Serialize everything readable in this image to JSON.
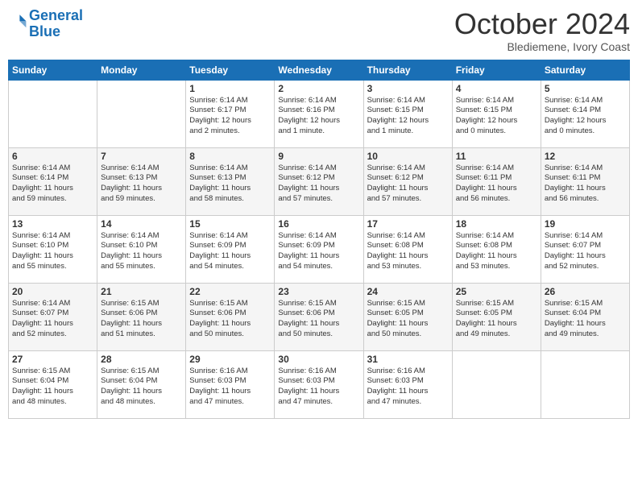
{
  "logo": {
    "line1": "General",
    "line2": "Blue"
  },
  "title": "October 2024",
  "location": "Blediemene, Ivory Coast",
  "days_header": [
    "Sunday",
    "Monday",
    "Tuesday",
    "Wednesday",
    "Thursday",
    "Friday",
    "Saturday"
  ],
  "weeks": [
    [
      {
        "day": "",
        "info": ""
      },
      {
        "day": "",
        "info": ""
      },
      {
        "day": "1",
        "info": "Sunrise: 6:14 AM\nSunset: 6:17 PM\nDaylight: 12 hours\nand 2 minutes."
      },
      {
        "day": "2",
        "info": "Sunrise: 6:14 AM\nSunset: 6:16 PM\nDaylight: 12 hours\nand 1 minute."
      },
      {
        "day": "3",
        "info": "Sunrise: 6:14 AM\nSunset: 6:15 PM\nDaylight: 12 hours\nand 1 minute."
      },
      {
        "day": "4",
        "info": "Sunrise: 6:14 AM\nSunset: 6:15 PM\nDaylight: 12 hours\nand 0 minutes."
      },
      {
        "day": "5",
        "info": "Sunrise: 6:14 AM\nSunset: 6:14 PM\nDaylight: 12 hours\nand 0 minutes."
      }
    ],
    [
      {
        "day": "6",
        "info": "Sunrise: 6:14 AM\nSunset: 6:14 PM\nDaylight: 11 hours\nand 59 minutes."
      },
      {
        "day": "7",
        "info": "Sunrise: 6:14 AM\nSunset: 6:13 PM\nDaylight: 11 hours\nand 59 minutes."
      },
      {
        "day": "8",
        "info": "Sunrise: 6:14 AM\nSunset: 6:13 PM\nDaylight: 11 hours\nand 58 minutes."
      },
      {
        "day": "9",
        "info": "Sunrise: 6:14 AM\nSunset: 6:12 PM\nDaylight: 11 hours\nand 57 minutes."
      },
      {
        "day": "10",
        "info": "Sunrise: 6:14 AM\nSunset: 6:12 PM\nDaylight: 11 hours\nand 57 minutes."
      },
      {
        "day": "11",
        "info": "Sunrise: 6:14 AM\nSunset: 6:11 PM\nDaylight: 11 hours\nand 56 minutes."
      },
      {
        "day": "12",
        "info": "Sunrise: 6:14 AM\nSunset: 6:11 PM\nDaylight: 11 hours\nand 56 minutes."
      }
    ],
    [
      {
        "day": "13",
        "info": "Sunrise: 6:14 AM\nSunset: 6:10 PM\nDaylight: 11 hours\nand 55 minutes."
      },
      {
        "day": "14",
        "info": "Sunrise: 6:14 AM\nSunset: 6:10 PM\nDaylight: 11 hours\nand 55 minutes."
      },
      {
        "day": "15",
        "info": "Sunrise: 6:14 AM\nSunset: 6:09 PM\nDaylight: 11 hours\nand 54 minutes."
      },
      {
        "day": "16",
        "info": "Sunrise: 6:14 AM\nSunset: 6:09 PM\nDaylight: 11 hours\nand 54 minutes."
      },
      {
        "day": "17",
        "info": "Sunrise: 6:14 AM\nSunset: 6:08 PM\nDaylight: 11 hours\nand 53 minutes."
      },
      {
        "day": "18",
        "info": "Sunrise: 6:14 AM\nSunset: 6:08 PM\nDaylight: 11 hours\nand 53 minutes."
      },
      {
        "day": "19",
        "info": "Sunrise: 6:14 AM\nSunset: 6:07 PM\nDaylight: 11 hours\nand 52 minutes."
      }
    ],
    [
      {
        "day": "20",
        "info": "Sunrise: 6:14 AM\nSunset: 6:07 PM\nDaylight: 11 hours\nand 52 minutes."
      },
      {
        "day": "21",
        "info": "Sunrise: 6:15 AM\nSunset: 6:06 PM\nDaylight: 11 hours\nand 51 minutes."
      },
      {
        "day": "22",
        "info": "Sunrise: 6:15 AM\nSunset: 6:06 PM\nDaylight: 11 hours\nand 50 minutes."
      },
      {
        "day": "23",
        "info": "Sunrise: 6:15 AM\nSunset: 6:06 PM\nDaylight: 11 hours\nand 50 minutes."
      },
      {
        "day": "24",
        "info": "Sunrise: 6:15 AM\nSunset: 6:05 PM\nDaylight: 11 hours\nand 50 minutes."
      },
      {
        "day": "25",
        "info": "Sunrise: 6:15 AM\nSunset: 6:05 PM\nDaylight: 11 hours\nand 49 minutes."
      },
      {
        "day": "26",
        "info": "Sunrise: 6:15 AM\nSunset: 6:04 PM\nDaylight: 11 hours\nand 49 minutes."
      }
    ],
    [
      {
        "day": "27",
        "info": "Sunrise: 6:15 AM\nSunset: 6:04 PM\nDaylight: 11 hours\nand 48 minutes."
      },
      {
        "day": "28",
        "info": "Sunrise: 6:15 AM\nSunset: 6:04 PM\nDaylight: 11 hours\nand 48 minutes."
      },
      {
        "day": "29",
        "info": "Sunrise: 6:16 AM\nSunset: 6:03 PM\nDaylight: 11 hours\nand 47 minutes."
      },
      {
        "day": "30",
        "info": "Sunrise: 6:16 AM\nSunset: 6:03 PM\nDaylight: 11 hours\nand 47 minutes."
      },
      {
        "day": "31",
        "info": "Sunrise: 6:16 AM\nSunset: 6:03 PM\nDaylight: 11 hours\nand 47 minutes."
      },
      {
        "day": "",
        "info": ""
      },
      {
        "day": "",
        "info": ""
      }
    ]
  ]
}
